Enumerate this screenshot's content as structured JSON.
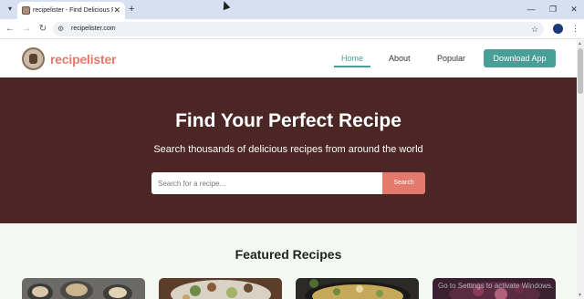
{
  "browser": {
    "tab_title": "recipelister - Find Delicious Re",
    "new_tab_icon": "+",
    "url": "recipelister.com",
    "window_controls": [
      "minimize",
      "restore",
      "close"
    ]
  },
  "header": {
    "brand": "recipelister",
    "nav": [
      {
        "label": "Home",
        "active": true
      },
      {
        "label": "About",
        "active": false
      },
      {
        "label": "Popular",
        "active": false
      }
    ],
    "download_label": "Download App"
  },
  "hero": {
    "title": "Find Your Perfect Recipe",
    "subtitle": "Search thousands of delicious recipes from around the world",
    "search_placeholder": "Search for a recipe...",
    "search_button": "Search"
  },
  "featured": {
    "title": "Featured Recipes",
    "cards": [
      {
        "icon": "food-photo"
      },
      {
        "icon": "food-photo"
      },
      {
        "icon": "food-photo"
      },
      {
        "icon": "food-photo"
      }
    ]
  },
  "watermark": "Go to Settings to activate Windows.",
  "colors": {
    "brand": "#e47a6b",
    "accent": "#4a9e98",
    "hero_bg": "#4c2624",
    "featured_bg": "#f4f8f3"
  }
}
